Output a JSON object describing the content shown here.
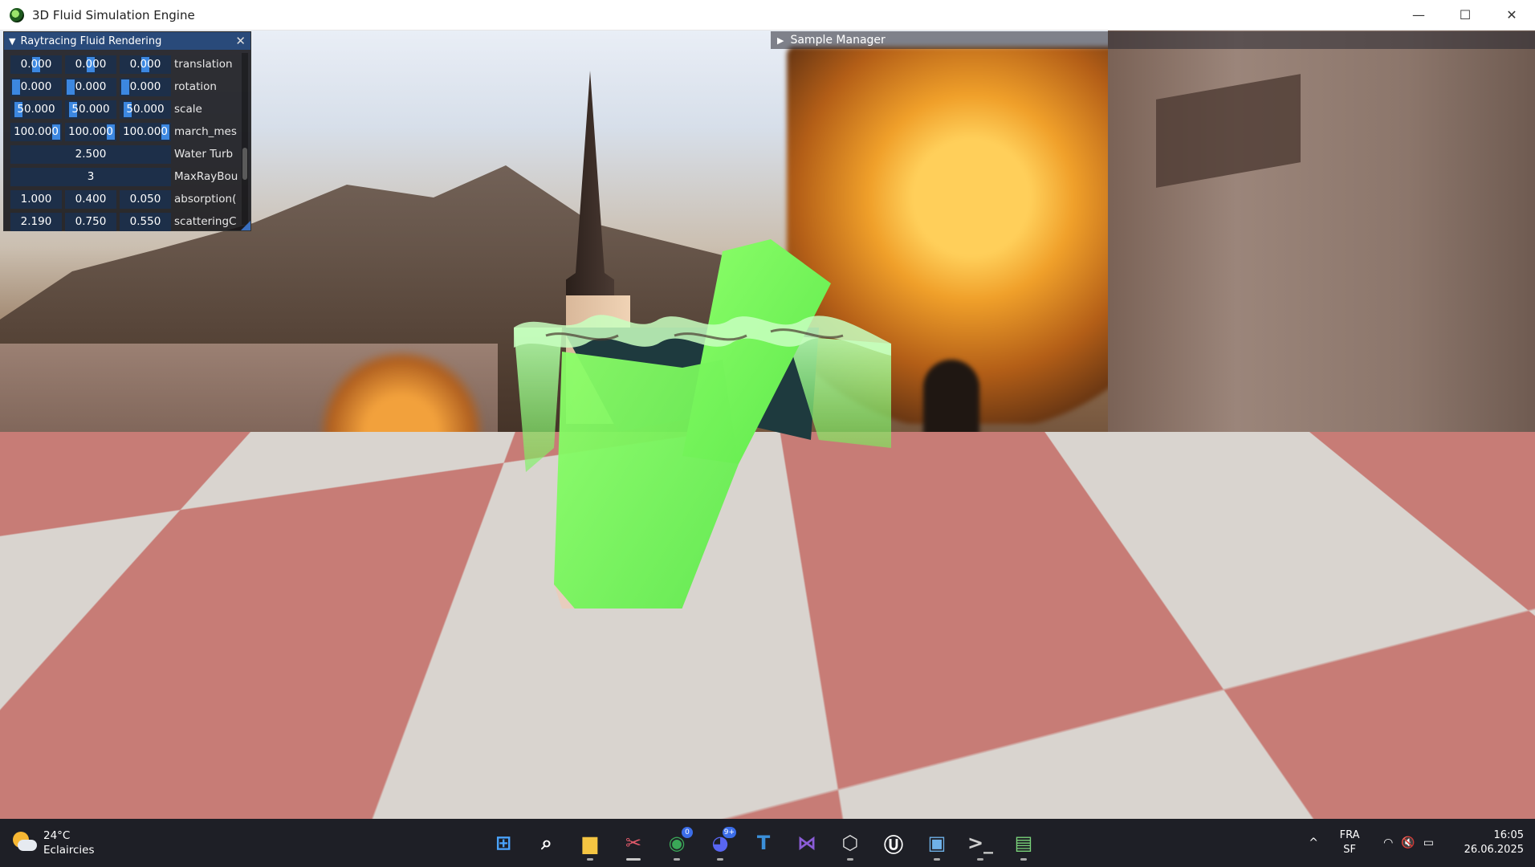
{
  "window": {
    "title": "3D Fluid Simulation Engine",
    "minimize_glyph": "—",
    "maximize_glyph": "☐",
    "close_glyph": "✕"
  },
  "panel": {
    "title": "Raytracing Fluid Rendering",
    "collapse_glyph": "▼",
    "close_glyph": "✕",
    "rows": [
      {
        "values": [
          "0.000",
          "0.000",
          "0.000"
        ],
        "label": "translation"
      },
      {
        "values": [
          "0.000",
          "0.000",
          "0.000"
        ],
        "label": "rotation"
      },
      {
        "values": [
          "50.000",
          "50.000",
          "50.000"
        ],
        "label": "scale"
      },
      {
        "values": [
          "100.000",
          "100.000",
          "100.000"
        ],
        "label": "march_mes"
      },
      {
        "value": "2.500",
        "label": "Water Turb"
      },
      {
        "value": "3",
        "label": "MaxRayBou"
      },
      {
        "values": [
          "1.000",
          "0.400",
          "0.050"
        ],
        "label": "absorption("
      },
      {
        "values": [
          "2.190",
          "0.750",
          "0.550"
        ],
        "label": "scatteringC"
      }
    ]
  },
  "sample_manager": {
    "label": "Sample Manager",
    "expand_glyph": "▶"
  },
  "taskbar": {
    "weather": {
      "temp": "24°C",
      "condition": "Eclaircies"
    },
    "apps": [
      {
        "name": "start-button",
        "glyph": "⊞",
        "color": "#4aa3ff"
      },
      {
        "name": "search-button",
        "glyph": "⌕",
        "color": "#ffffff"
      },
      {
        "name": "file-explorer",
        "glyph": "▆",
        "color": "#f5c542"
      },
      {
        "name": "snipping-tool",
        "glyph": "✂",
        "color": "#e05a6a"
      },
      {
        "name": "chrome",
        "glyph": "◉",
        "color": "#3aa757",
        "badge": "0"
      },
      {
        "name": "discord",
        "glyph": "◕",
        "color": "#5865f2",
        "badge": "9+"
      },
      {
        "name": "typora",
        "glyph": "T",
        "color": "#3b8fd9"
      },
      {
        "name": "visual-studio",
        "glyph": "⋈",
        "color": "#8a5cd6"
      },
      {
        "name": "unity",
        "glyph": "⬡",
        "color": "#dddddd"
      },
      {
        "name": "unreal-engine",
        "glyph": "Ⓤ",
        "color": "#ffffff"
      },
      {
        "name": "app-window",
        "glyph": "▣",
        "color": "#6fb1e8"
      },
      {
        "name": "terminal",
        "glyph": ">_",
        "color": "#cfcfcf"
      },
      {
        "name": "fluid-app",
        "glyph": "▤",
        "color": "#7ad37a"
      }
    ],
    "tray": {
      "chevron": "^",
      "lang_line1": "FRA",
      "lang_line2": "SF",
      "wifi": "◠",
      "volume": "🔇",
      "battery": "▭",
      "time": "16:05",
      "date": "26.06.2025"
    }
  }
}
